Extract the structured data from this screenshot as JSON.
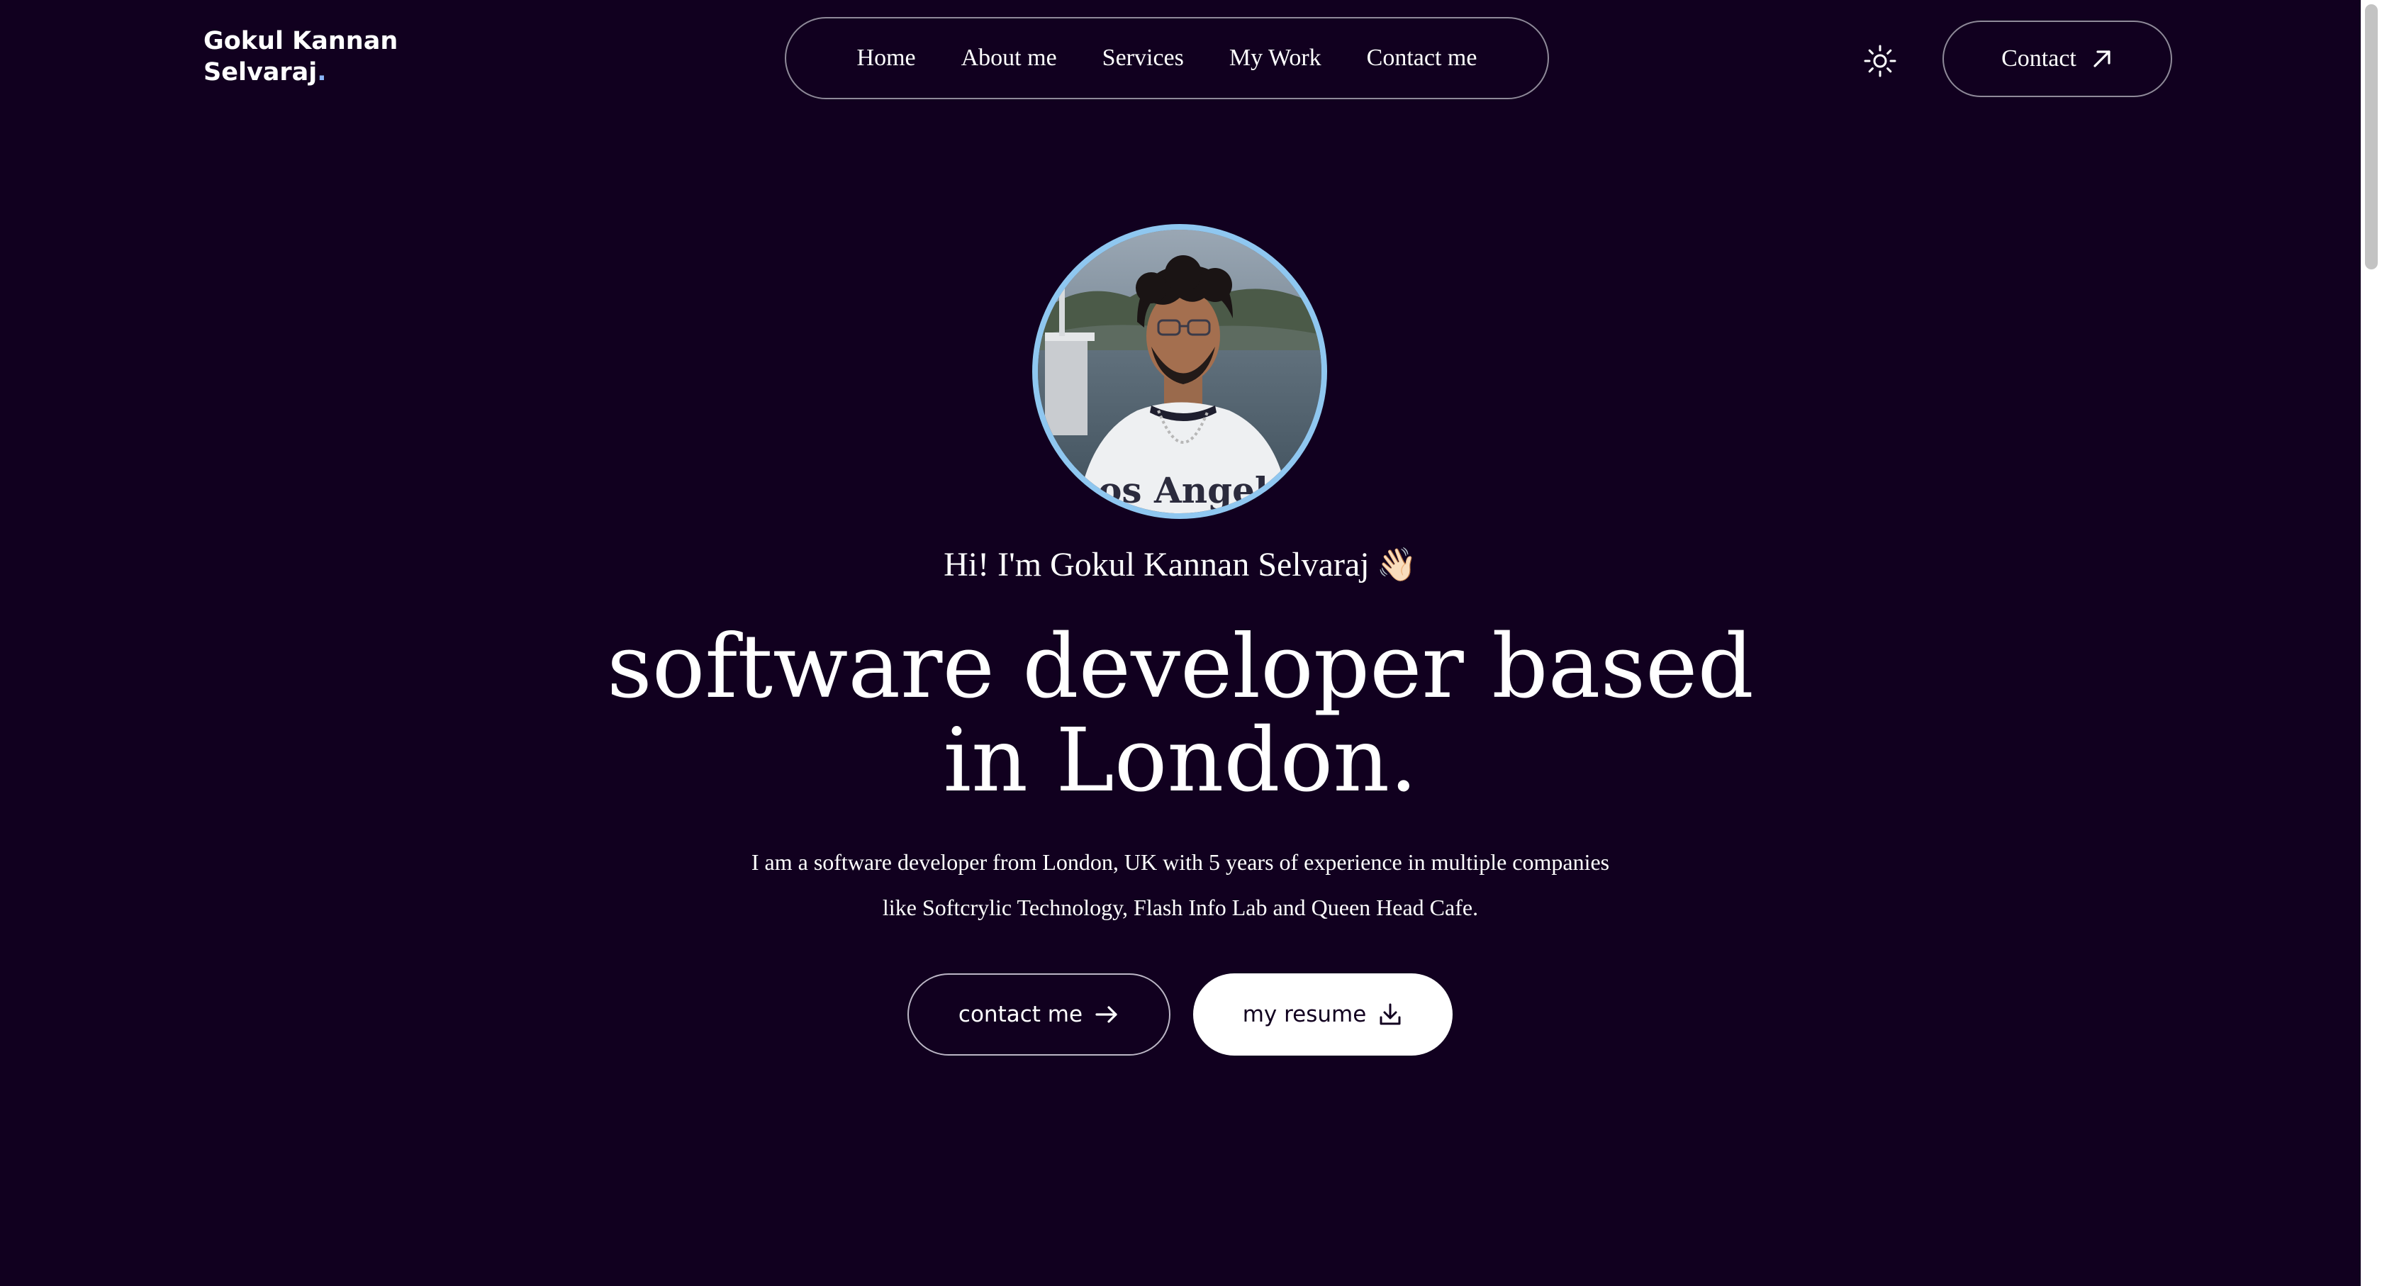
{
  "logo": {
    "line1": "Gokul Kannan",
    "line2": "Selvaraj",
    "dot": "."
  },
  "nav": {
    "items": [
      {
        "label": "Home"
      },
      {
        "label": "About me"
      },
      {
        "label": "Services"
      },
      {
        "label": "My Work"
      },
      {
        "label": "Contact me"
      }
    ]
  },
  "header": {
    "theme_icon": "sun-icon",
    "contact_label": "Contact",
    "contact_icon": "arrow-up-right-icon"
  },
  "hero": {
    "avatar_alt": "profile-photo",
    "greeting": "Hi! I'm Gokul Kannan Selvaraj",
    "wave_emoji": "👋🏻",
    "headline_line1": "software developer based",
    "headline_line2": "in London.",
    "desc_line1": "I am a software developer from London, UK with 5 years of experience in multiple companies",
    "desc_line2": "like Softcrylic Technology, Flash Info Lab and Queen Head Cafe.",
    "cta_contact": "contact me",
    "cta_contact_icon": "arrow-right-icon",
    "cta_resume": "my resume",
    "cta_resume_icon": "download-icon"
  },
  "colors": {
    "background": "#11001f",
    "avatar_ring": "#8fc7f0",
    "logo_dot": "#8ab4f8",
    "text": "#ffffff"
  }
}
